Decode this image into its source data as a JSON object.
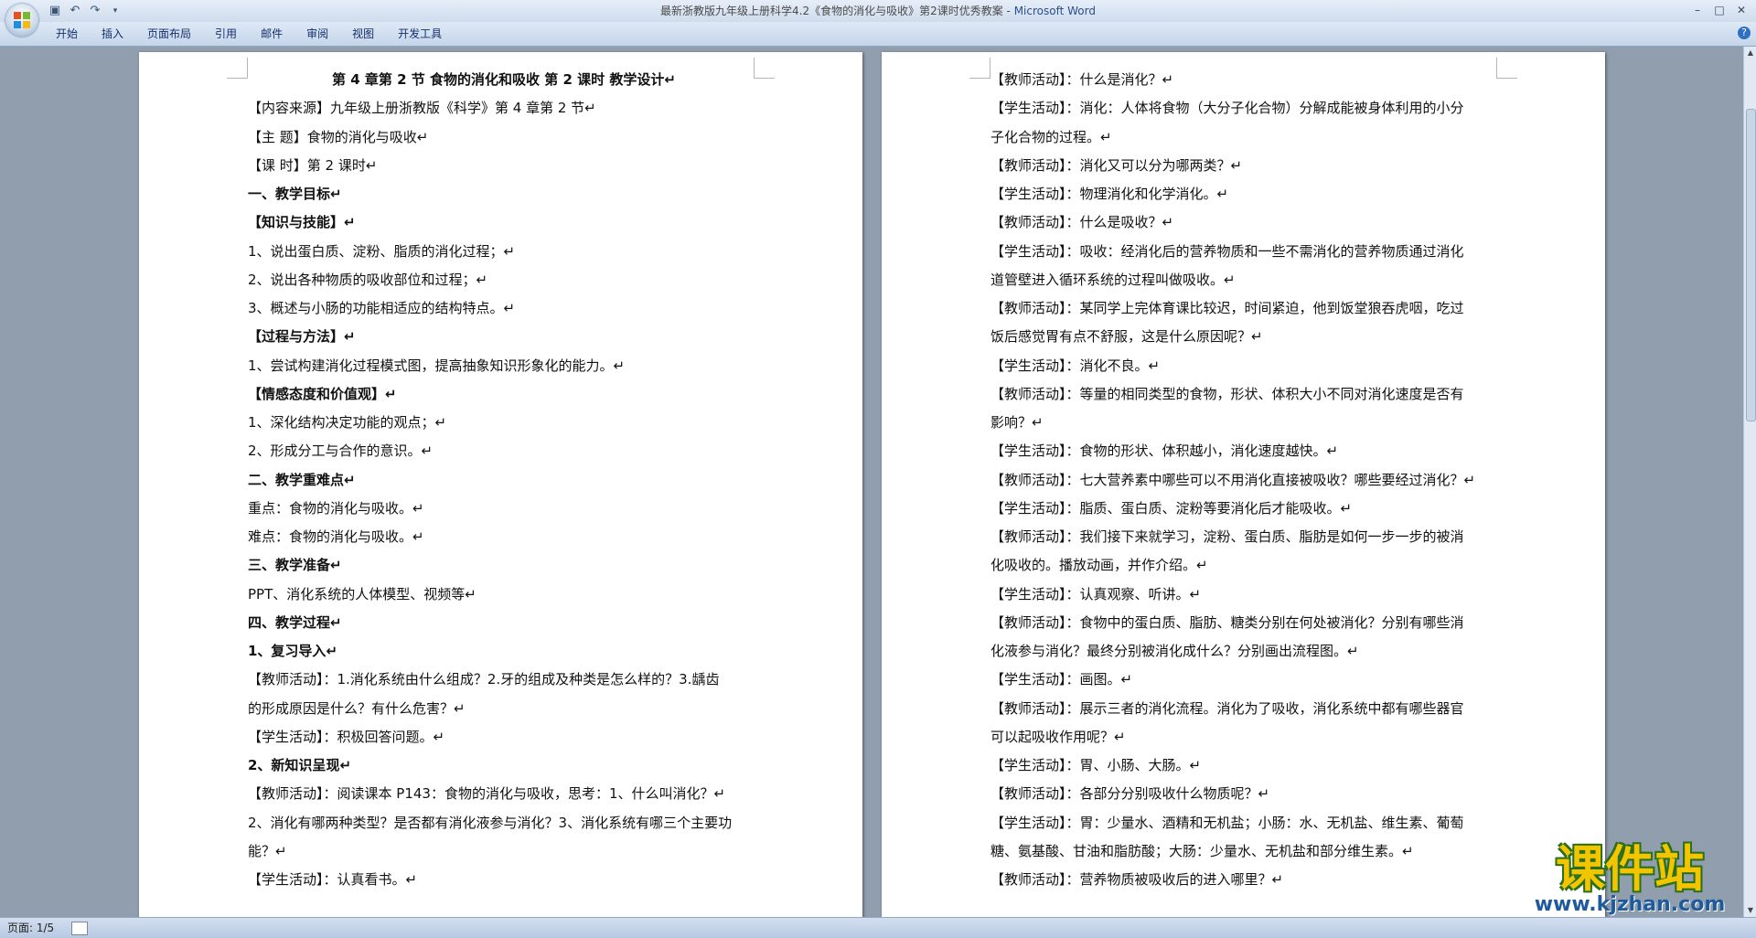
{
  "window": {
    "doc_title": "最新浙教版九年级上册科学4.2《食物的消化与吸收》第2课时优秀教案",
    "app_name": "Microsoft Word",
    "separator": " - "
  },
  "ribbon": {
    "tabs": [
      "开始",
      "插入",
      "页面布局",
      "引用",
      "邮件",
      "审阅",
      "视图",
      "开发工具"
    ]
  },
  "icons": {
    "office_button": "office-logo-icon",
    "qat": [
      "save-icon",
      "undo-icon",
      "redo-icon",
      "customize-qat-icon"
    ],
    "window": [
      "minimize-icon",
      "maximize-icon",
      "close-icon"
    ],
    "help": "help-icon"
  },
  "colors": {
    "logo_orange": "#e8501f",
    "logo_green": "#7cb82f",
    "logo_blue": "#1e8ee0",
    "logo_yellow": "#f9b90f"
  },
  "page_left": [
    {
      "text": "第 4 章第 2 节  食物的消化和吸收  第 2 课时  教学设计↵",
      "style": "b center"
    },
    {
      "text": "【内容来源】九年级上册浙教版《科学》第 4 章第 2 节↵",
      "style": ""
    },
    {
      "text": "【主      题】食物的消化与吸收↵",
      "style": ""
    },
    {
      "text": "【课      时】第 2 课时↵",
      "style": ""
    },
    {
      "text": "一、教学目标↵",
      "style": "b"
    },
    {
      "text": "【知识与技能】↵",
      "style": "b"
    },
    {
      "text": "1、说出蛋白质、淀粉、脂质的消化过程；↵",
      "style": ""
    },
    {
      "text": "2、说出各种物质的吸收部位和过程；↵",
      "style": ""
    },
    {
      "text": "3、概述与小肠的功能相适应的结构特点。↵",
      "style": ""
    },
    {
      "text": "【过程与方法】↵",
      "style": "b"
    },
    {
      "text": "1、尝试构建消化过程模式图，提高抽象知识形象化的能力。↵",
      "style": ""
    },
    {
      "text": "【情感态度和价值观】↵",
      "style": "b"
    },
    {
      "text": "1、深化结构决定功能的观点；↵",
      "style": ""
    },
    {
      "text": "2、形成分工与合作的意识。↵",
      "style": ""
    },
    {
      "text": "二、教学重难点↵",
      "style": "b"
    },
    {
      "text": "重点：食物的消化与吸收。↵",
      "style": ""
    },
    {
      "text": "难点：食物的消化与吸收。↵",
      "style": ""
    },
    {
      "text": "三、教学准备↵",
      "style": "b"
    },
    {
      "text": "PPT、消化系统的人体模型、视频等↵",
      "style": ""
    },
    {
      "text": "四、教学过程↵",
      "style": "b"
    },
    {
      "text": "1、复习导入↵",
      "style": "b"
    },
    {
      "text": "【教师活动】：1.消化系统由什么组成？2.牙的组成及种类是怎么样的？3.龋齿",
      "style": ""
    },
    {
      "text": "的形成原因是什么？有什么危害？↵",
      "style": ""
    },
    {
      "text": "【学生活动】：积极回答问题。↵",
      "style": ""
    },
    {
      "text": "2、新知识呈现↵",
      "style": "b"
    },
    {
      "text": "【教师活动】：阅读课本 P143：食物的消化与吸收，思考：1、什么叫消化？↵",
      "style": ""
    },
    {
      "text": "2、消化有哪两种类型？是否都有消化液参与消化？3、消化系统有哪三个主要功",
      "style": ""
    },
    {
      "text": "能？↵",
      "style": ""
    },
    {
      "text": "【学生活动】：认真看书。↵",
      "style": ""
    }
  ],
  "page_right": [
    {
      "text": "【教师活动】：什么是消化？↵",
      "style": ""
    },
    {
      "text": "【学生活动】：消化：人体将食物（大分子化合物）分解成能被身体利用的小分",
      "style": ""
    },
    {
      "text": "子化合物的过程。↵",
      "style": ""
    },
    {
      "text": "【教师活动】：消化又可以分为哪两类？↵",
      "style": ""
    },
    {
      "text": "【学生活动】：物理消化和化学消化。↵",
      "style": ""
    },
    {
      "text": "【教师活动】：什么是吸收？↵",
      "style": ""
    },
    {
      "text": "【学生活动】：吸收：经消化后的营养物质和一些不需消化的营养物质通过消化",
      "style": ""
    },
    {
      "text": "道管壁进入循环系统的过程叫做吸收。↵",
      "style": ""
    },
    {
      "text": "【教师活动】：某同学上完体育课比较迟，时间紧迫，他到饭堂狼吞虎咽，吃过",
      "style": ""
    },
    {
      "text": "饭后感觉胃有点不舒服，这是什么原因呢？↵",
      "style": ""
    },
    {
      "text": "【学生活动】：消化不良。↵",
      "style": ""
    },
    {
      "text": "【教师活动】：等量的相同类型的食物，形状、体积大小不同对消化速度是否有",
      "style": ""
    },
    {
      "text": "影响？↵",
      "style": ""
    },
    {
      "text": "【学生活动】：食物的形状、体积越小，消化速度越快。↵",
      "style": ""
    },
    {
      "text": "【教师活动】：七大营养素中哪些可以不用消化直接被吸收？哪些要经过消化？↵",
      "style": ""
    },
    {
      "text": "【学生活动】：脂质、蛋白质、淀粉等要消化后才能吸收。↵",
      "style": ""
    },
    {
      "text": "【教师活动】：我们接下来就学习，淀粉、蛋白质、脂肪是如何一步一步的被消",
      "style": ""
    },
    {
      "text": "化吸收的。播放动画，并作介绍。↵",
      "style": ""
    },
    {
      "text": "【学生活动】：认真观察、听讲。↵",
      "style": ""
    },
    {
      "text": "【教师活动】：食物中的蛋白质、脂肪、糖类分别在何处被消化？分别有哪些消",
      "style": ""
    },
    {
      "text": "化液参与消化？最终分别被消化成什么？分别画出流程图。↵",
      "style": ""
    },
    {
      "text": "【学生活动】：画图。↵",
      "style": ""
    },
    {
      "text": "【教师活动】：展示三者的消化流程。消化为了吸收，消化系统中都有哪些器官",
      "style": ""
    },
    {
      "text": "可以起吸收作用呢？↵",
      "style": ""
    },
    {
      "text": "【学生活动】：胃、小肠、大肠。↵",
      "style": ""
    },
    {
      "text": "【教师活动】：各部分分别吸收什么物质呢？↵",
      "style": ""
    },
    {
      "text": "【学生活动】：胃：少量水、酒精和无机盐；小肠：水、无机盐、维生素、葡萄",
      "style": ""
    },
    {
      "text": "糖、氨基酸、甘油和脂肪酸；大肠：少量水、无机盐和部分维生素。↵",
      "style": ""
    },
    {
      "text": "【教师活动】：营养物质被吸收后的进入哪里？↵",
      "style": ""
    }
  ],
  "status": {
    "page_info": "页面: 1/5"
  },
  "watermark": {
    "main": "课件站",
    "url": "www.kjzhan.com"
  }
}
